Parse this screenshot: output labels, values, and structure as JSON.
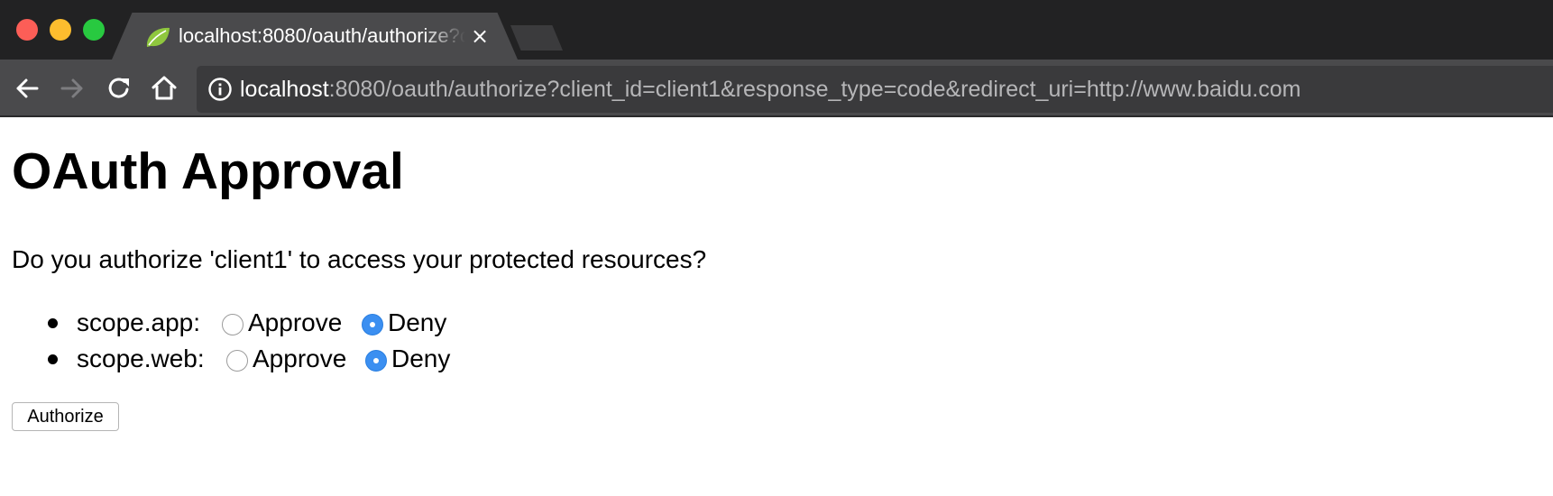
{
  "browser": {
    "tab": {
      "title": "localhost:8080/oauth/authorize?client_id=client1&response_type=code&redirect_uri=http://www.baidu.com",
      "favicon": "spring-leaf-icon",
      "close_glyph": "×"
    },
    "toolbar": {
      "url_host": "localhost",
      "url_rest": ":8080/oauth/authorize?client_id=client1&response_type=code&redirect_uri=http://www.baidu.com"
    }
  },
  "page": {
    "heading": "OAuth Approval",
    "question": "Do you authorize 'client1' to access your protected resources?",
    "scopes": [
      {
        "name": "scope.app:",
        "approve_label": "Approve",
        "deny_label": "Deny",
        "selected": "Deny"
      },
      {
        "name": "scope.web:",
        "approve_label": "Approve",
        "deny_label": "Deny",
        "selected": "Deny"
      }
    ],
    "submit_label": "Authorize"
  },
  "colors": {
    "titlebar": "#222223",
    "toolbar": "#4a4a4c",
    "radio_checked": "#3b8ff1",
    "favicon_green": "#8fc73e"
  }
}
